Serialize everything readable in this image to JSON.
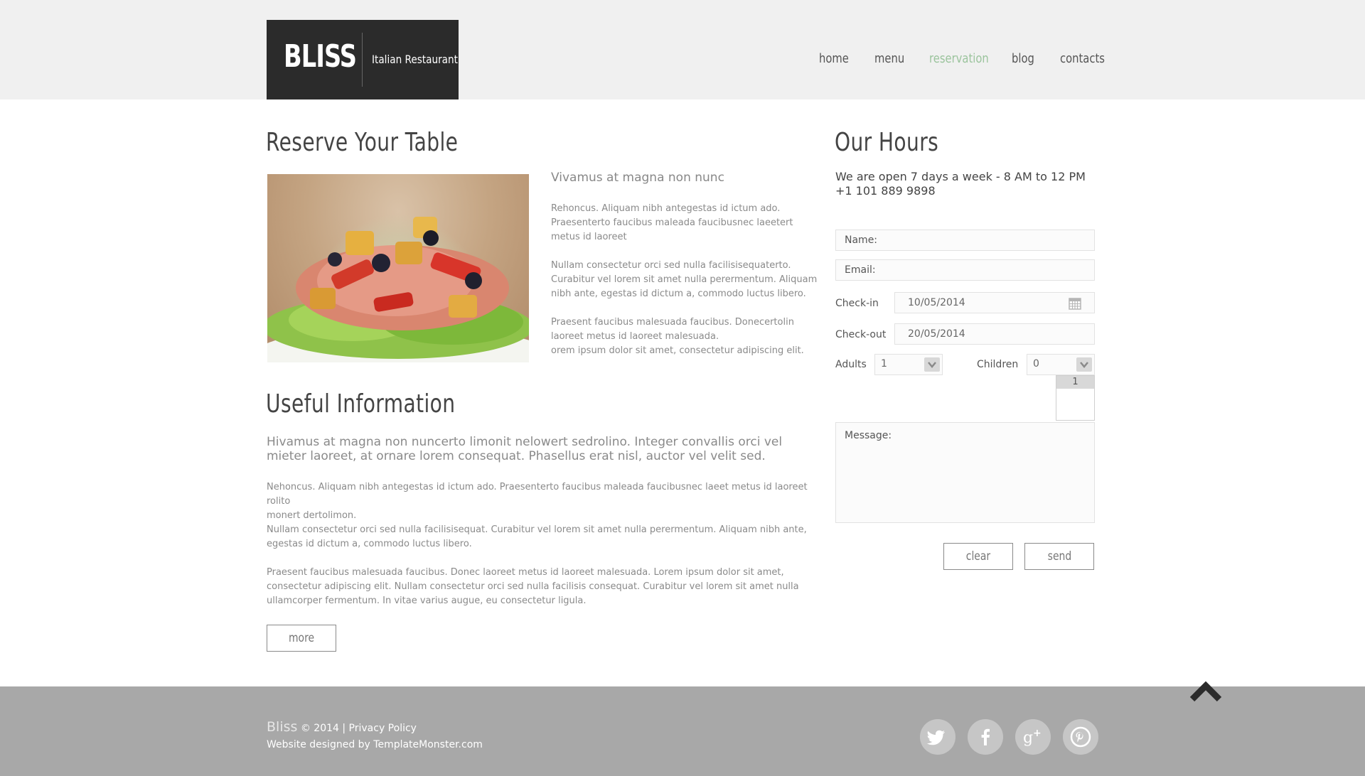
{
  "brand": {
    "name": "BLISS",
    "tagline": "Italian Restaurant"
  },
  "nav": {
    "items": [
      {
        "label": "home"
      },
      {
        "label": "menu"
      },
      {
        "label": "reservation"
      },
      {
        "label": "blog"
      },
      {
        "label": "contacts"
      }
    ],
    "active_color": "#9bc49d"
  },
  "reserve": {
    "title": "Reserve Your Table",
    "subtitle": "Vivamus at magna non nunc",
    "paragraphs": [
      [
        "Rehoncus. Aliquam nibh antegestas id ictum ado.",
        "Praesenterto faucibus maleada faucibusnec laeetert",
        "metus id laoreet"
      ],
      [
        "Nullam consectetur orci sed nulla facilisisequaterto.",
        "Curabitur vel lorem sit amet nulla perermentum. Aliquam",
        "nibh ante, egestas id dictum a, commodo luctus libero."
      ],
      [
        "Praesent faucibus malesuada faucibus. Donecertolin",
        "laoreet metus id laoreet malesuada.",
        "orem ipsum dolor sit amet, consectetur adipiscing elit."
      ]
    ]
  },
  "useful": {
    "title": "Useful Information",
    "lead": "Hivamus at magna non nuncerto limonit nelowert sedrolino. Integer convallis orci vel mieter laoreet, at ornare lorem consequat. Phasellus erat nisl, auctor vel velit sed.",
    "paragraphs": [
      [
        "Nehoncus. Aliquam nibh antegestas id ictum ado. Praesenterto faucibus maleada faucibusnec laeet metus id laoreet rolito",
        "monert dertolimon."
      ],
      [
        "Nullam consectetur orci sed nulla facilisisequat. Curabitur vel lorem sit amet nulla perermentum. Aliquam nibh ante,",
        "egestas id dictum a, commodo luctus libero."
      ],
      [
        "Praesent faucibus malesuada faucibus. Donec laoreet metus id laoreet malesuada. Lorem ipsum dolor sit amet,",
        "consectetur adipiscing elit. Nullam consectetur orci sed nulla facilisis consequat. Curabitur vel lorem sit amet nulla",
        "ullamcorper fermentum. In vitae varius augue, eu consectetur ligula."
      ]
    ],
    "more_label": "more"
  },
  "hours": {
    "title": "Our Hours",
    "line1": "We are open 7 days a week - 8 AM to 12 PM",
    "phone": "+1 101 889 9898"
  },
  "form": {
    "name_label": "Name:",
    "email_label": "Email:",
    "checkin_label": "Check-in",
    "checkin_value": "10/05/2014",
    "checkout_label": "Check-out",
    "checkout_value": "20/05/2014",
    "adults_label": "Adults",
    "adults_value": "1",
    "children_label": "Children",
    "children_value": "0",
    "children_dropdown_option": "1",
    "message_label": "Message:",
    "clear_label": "clear",
    "send_label": "send"
  },
  "footer": {
    "brand": "Bliss",
    "copyright": "© 2014 |",
    "privacy": "Privacy Policy",
    "designed_by": "Website designed by",
    "designer": "TemplateMonster.com",
    "social": [
      "twitter",
      "facebook",
      "google-plus",
      "pinterest"
    ]
  }
}
